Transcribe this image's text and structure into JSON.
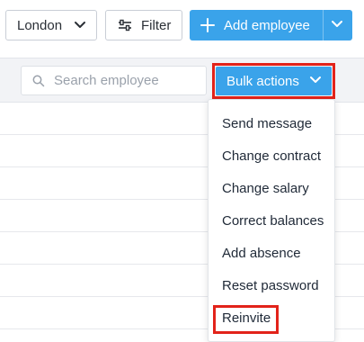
{
  "topbar": {
    "location_label": "London",
    "filter_label": "Filter",
    "add_employee_label": "Add employee"
  },
  "toolbar": {
    "search_placeholder": "Search employee",
    "bulk_actions_label": "Bulk actions"
  },
  "bulk_menu": {
    "items": [
      {
        "label": "Send message"
      },
      {
        "label": "Change contract"
      },
      {
        "label": "Change salary"
      },
      {
        "label": "Correct balances"
      },
      {
        "label": "Add absence"
      },
      {
        "label": "Reset password"
      },
      {
        "label": "Reinvite"
      }
    ]
  },
  "colors": {
    "primary_blue": "#3aa3ea",
    "highlight_red": "#e2231a"
  },
  "icons": {
    "location_chevron": "chevron-down-icon",
    "filter": "sliders-icon",
    "add": "plus-icon",
    "add_chevron": "chevron-down-icon",
    "search": "search-icon",
    "bulk_chevron": "chevron-down-icon"
  }
}
